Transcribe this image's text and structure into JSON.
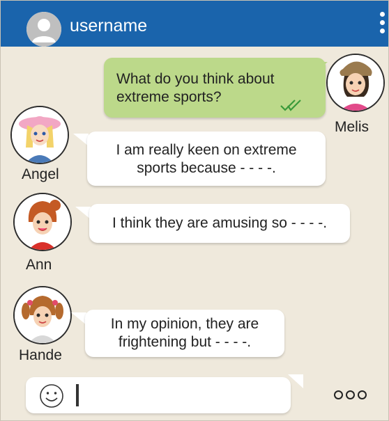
{
  "header": {
    "username": "username",
    "avatar_icon": "user-silhouette-icon",
    "menu_icon": "vertical-dots-icon"
  },
  "messages": [
    {
      "sender": "Melis",
      "text_lines": [
        "What do you think about",
        "extreme sports?"
      ],
      "status_icon": "double-check-icon",
      "side": "right"
    },
    {
      "sender": "Angel",
      "text_lines": [
        "I am really keen on extreme",
        "sports because - - - -."
      ],
      "side": "left"
    },
    {
      "sender": "Ann",
      "text_lines": [
        "I think they are amusing so - - - -."
      ],
      "side": "left"
    },
    {
      "sender": "Hande",
      "text_lines": [
        "In my opinion, they are",
        "frightening but - - - -."
      ],
      "side": "left"
    }
  ],
  "composer": {
    "emoji_icon": "smiley-icon",
    "more_icon": "three-circles-icon"
  },
  "colors": {
    "header": "#1a64ac",
    "background": "#efe9dc",
    "sent_bubble": "#bcd98a",
    "received_bubble": "#ffffff",
    "check": "#3a9a3a"
  }
}
